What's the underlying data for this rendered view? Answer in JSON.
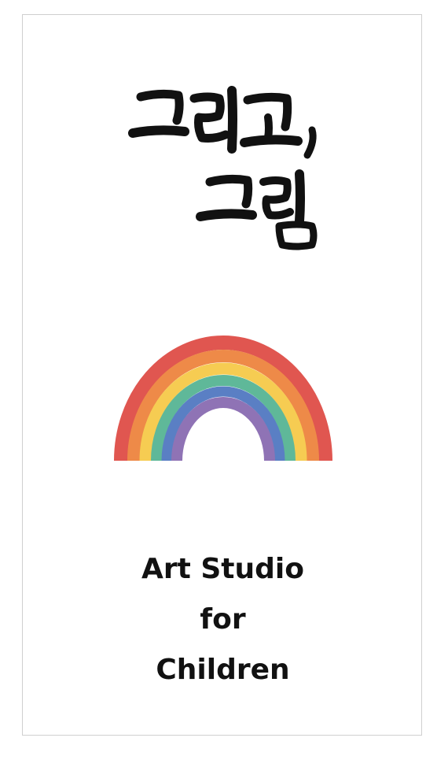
{
  "logo": {
    "korean_title_line1": "그리고,",
    "korean_title_line2": "그림"
  },
  "tagline": {
    "line1": "Art Studio",
    "line2": "for",
    "line3": "Children"
  },
  "colors": {
    "ink": "#111111",
    "border": "#cfcfcf",
    "rainbow_red": "#e05650",
    "rainbow_orange": "#ee8a48",
    "rainbow_yellow": "#f6cc52",
    "rainbow_green": "#5fb899",
    "rainbow_blue": "#5a7fc4",
    "rainbow_purple": "#8f73b5"
  }
}
